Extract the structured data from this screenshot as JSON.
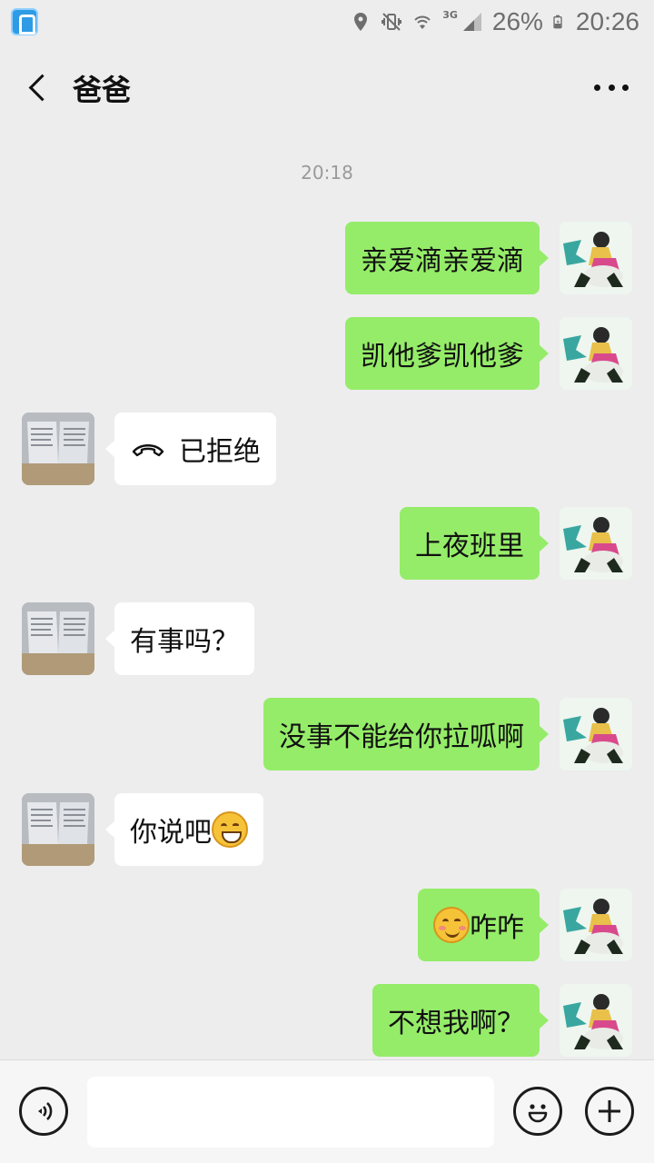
{
  "status_bar": {
    "battery": "26%",
    "time": "20:26",
    "network": "3G",
    "icons": [
      "app-notification-icon",
      "location-icon",
      "vibrate-off-icon",
      "wifi-icon",
      "signal-icon",
      "battery-charging-icon"
    ]
  },
  "header": {
    "title": "爸爸",
    "back_icon": "chevron-left-icon",
    "more_icon": "more-dots-icon"
  },
  "chat": {
    "timestamp": "20:18",
    "messages": [
      {
        "sender": "me",
        "text": "亲爱滴亲爱滴"
      },
      {
        "sender": "me",
        "text": "凯他爹凯他爹"
      },
      {
        "sender": "dad",
        "text": "已拒绝",
        "icon": "phone-hangup-icon"
      },
      {
        "sender": "me",
        "text": "上夜班里"
      },
      {
        "sender": "dad",
        "text": "有事吗？"
      },
      {
        "sender": "me",
        "text": "没事不能给你拉呱啊"
      },
      {
        "sender": "dad",
        "text": "你说吧",
        "emoji": "grin-emoji"
      },
      {
        "sender": "me",
        "text": "咋咋",
        "emoji": "smirk-emoji"
      },
      {
        "sender": "me",
        "text": "不想我啊？"
      }
    ]
  },
  "input_bar": {
    "voice_icon": "voice-icon",
    "text_value": "",
    "emoji_icon": "emoji-icon",
    "plus_icon": "plus-icon"
  },
  "colors": {
    "background": "#ededed",
    "my_bubble": "#95ec69",
    "their_bubble": "#ffffff",
    "input_bar": "#f6f6f6"
  }
}
